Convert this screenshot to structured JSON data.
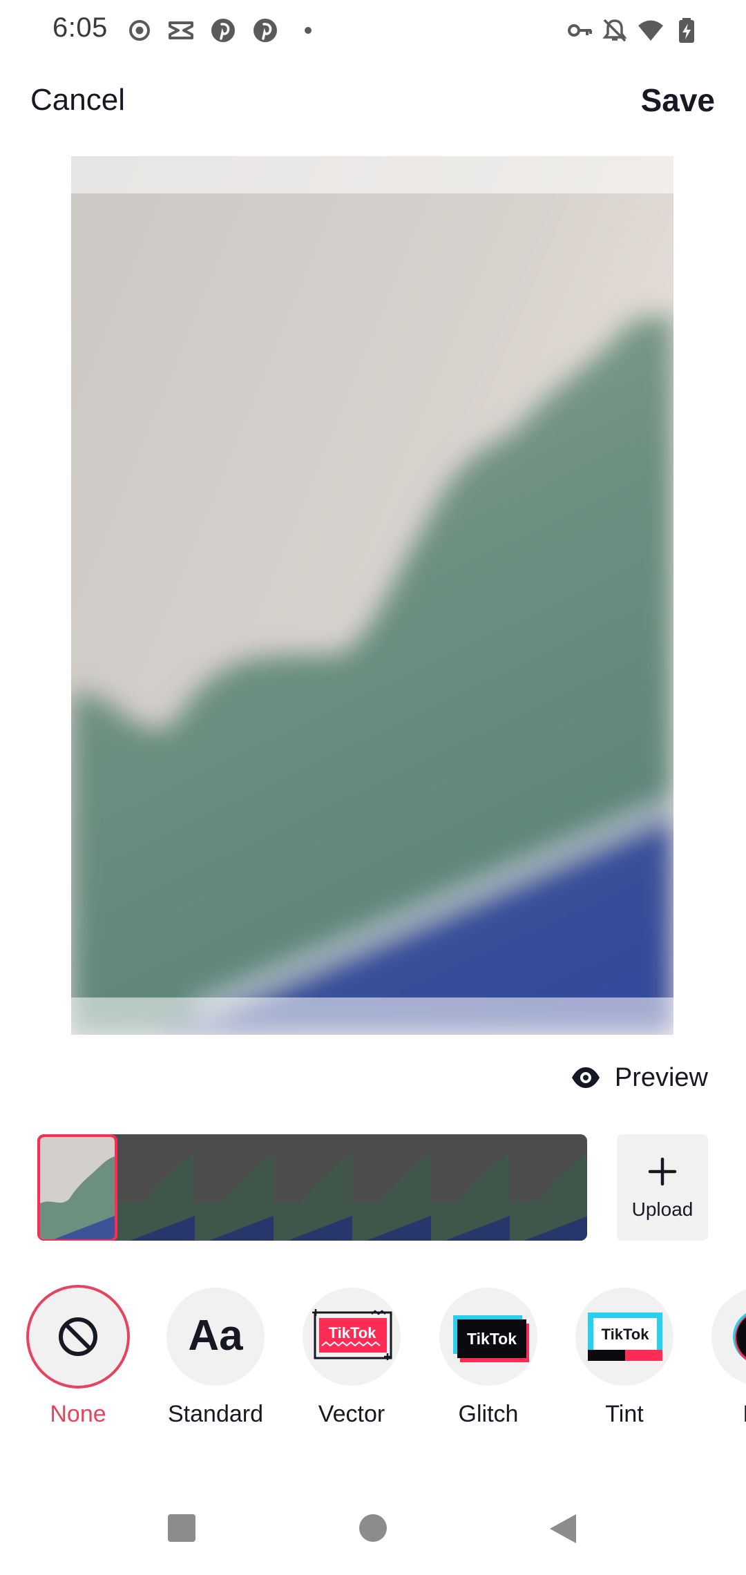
{
  "status_bar": {
    "time": "6:05",
    "left_icons": [
      "record-icon",
      "capcut-icon",
      "pinterest-icon",
      "pinterest-icon",
      "dot-icon"
    ],
    "right_icons": [
      "vpn-key-icon",
      "bell-off-icon",
      "wifi-icon",
      "battery-charging-icon"
    ]
  },
  "top_bar": {
    "cancel_label": "Cancel",
    "save_label": "Save"
  },
  "preview": {
    "label": "Preview",
    "icon": "eye-icon"
  },
  "frames": {
    "selected_index": 0,
    "count": 7
  },
  "upload": {
    "label": "Upload",
    "icon": "plus-icon"
  },
  "styles": {
    "items": [
      {
        "label": "None",
        "icon": "none-icon",
        "active": true
      },
      {
        "label": "Standard",
        "icon": "aa-text-icon"
      },
      {
        "label": "Vector",
        "icon": "tiktok-vector-icon"
      },
      {
        "label": "Glitch",
        "icon": "tiktok-glitch-icon"
      },
      {
        "label": "Tint",
        "icon": "tiktok-tint-icon"
      },
      {
        "label": "Em",
        "icon": "tiktok-logo-icon"
      }
    ],
    "badges": {
      "vector": "TikTok",
      "glitch": "TikTok",
      "tint": "TikTok"
    }
  },
  "colors": {
    "accent": "#fe2c55",
    "text": "#161823",
    "chip_bg": "#f1f1f2",
    "tiktok_cyan": "#25f4ee"
  },
  "nav_bar": {
    "buttons": [
      "recents-square-icon",
      "home-circle-icon",
      "back-triangle-icon"
    ]
  }
}
